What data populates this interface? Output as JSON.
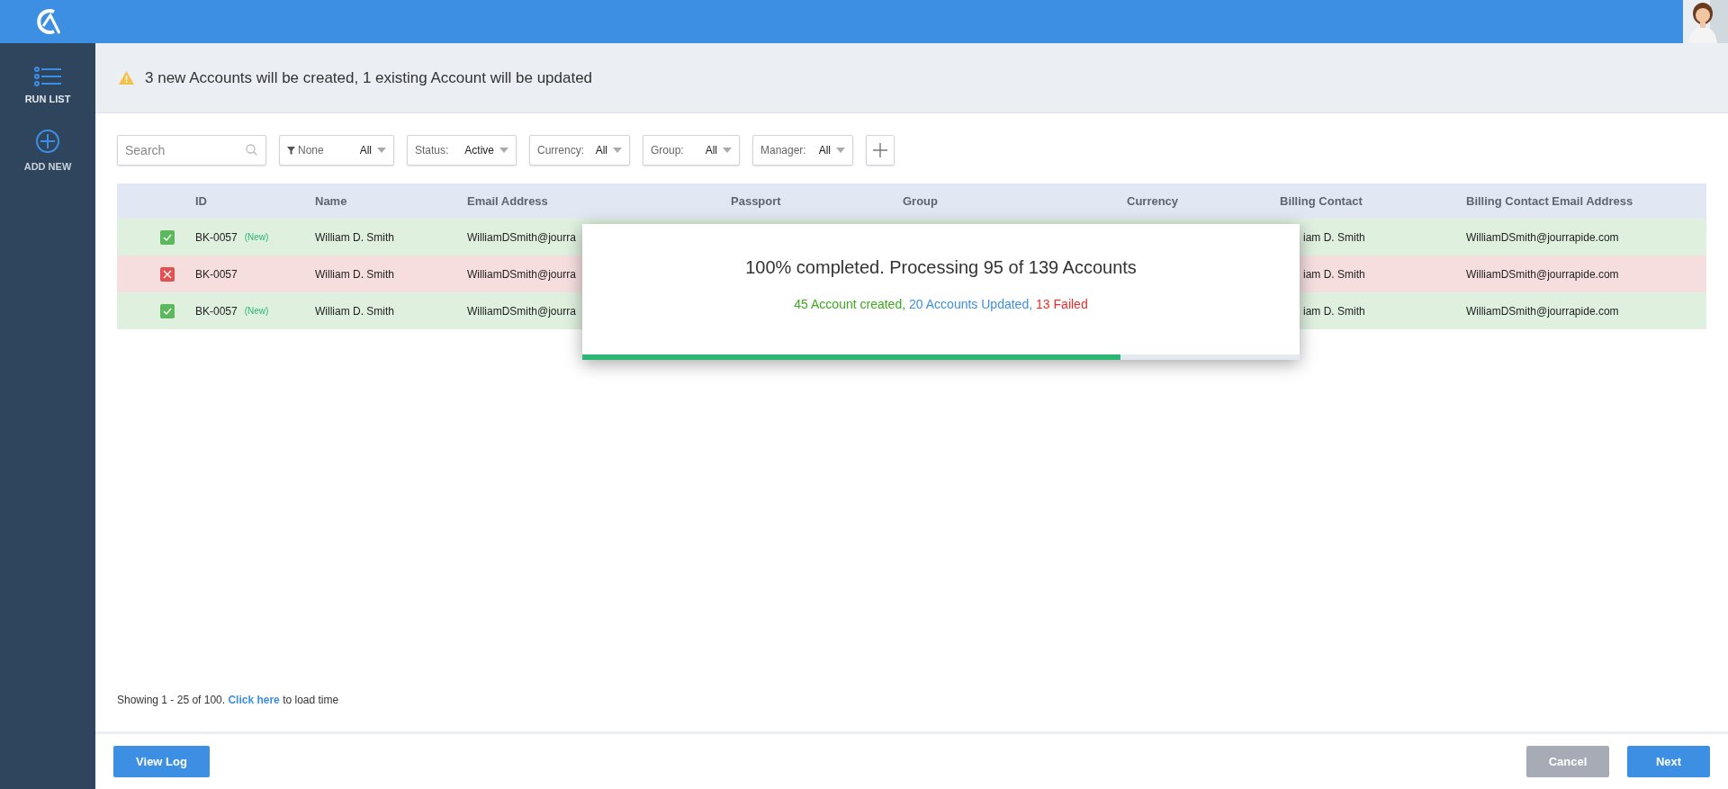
{
  "sidebar": {
    "items": [
      {
        "label": "RUN LIST",
        "kind": "list",
        "selected": true
      },
      {
        "label": "ADD NEW",
        "kind": "add",
        "selected": false
      }
    ]
  },
  "alert": {
    "text": "3 new Accounts will be created, 1 existing Account will be updated"
  },
  "filters": {
    "search": {
      "placeholder": "Search"
    },
    "dropdowns": [
      {
        "kind": "funnel",
        "label": "None",
        "value": "All"
      },
      {
        "kind": "plain",
        "label": "Status:",
        "value": "Active"
      },
      {
        "kind": "plain",
        "label": "Currency:",
        "value": "All"
      },
      {
        "kind": "plain",
        "label": "Group:",
        "value": "All"
      },
      {
        "kind": "plain",
        "label": "Manager:",
        "value": "All"
      }
    ]
  },
  "table": {
    "columns": [
      "ID",
      "Name",
      "Email Address",
      "Passport",
      "Group",
      "Currency",
      "Billing Contact",
      "Billing Contact Email Address"
    ],
    "rows": [
      {
        "failed": false,
        "id": "BK-0057",
        "badge": "(New)",
        "name": "William D. Smith",
        "email": "WilliamDSmith@jourra",
        "billing_contact": "iam D. Smith",
        "billing_email": "WilliamDSmith@jourrapide.com"
      },
      {
        "failed": true,
        "id": "BK-0057",
        "name": "William D. Smith",
        "email": "WilliamDSmith@jourra",
        "billing_contact": "iam D. Smith",
        "billing_email": "WilliamDSmith@jourrapide.com"
      },
      {
        "failed": false,
        "id": "BK-0057",
        "badge": "(New)",
        "name": "William D. Smith",
        "email": "WilliamDSmith@jourra",
        "billing_contact": "iam D. Smith",
        "billing_email": "WilliamDSmith@jourrapide.com"
      }
    ]
  },
  "progress_dialog": {
    "title": "100% completed. Processing 95 of 139 Accounts",
    "created": "45 Account created,",
    "updated": "20 Accounts Updated,",
    "failed": "13 Failed",
    "level": 0.75
  },
  "footer_note": {
    "before": "Showing 1 - 25 of 100.",
    "link": "Click here",
    "after": "to load time"
  },
  "buttons": [
    {
      "label": "View Log",
      "kind": "primary"
    },
    {
      "label": "Cancel",
      "kind": "secondary"
    },
    {
      "label": "Next",
      "kind": "primary"
    }
  ]
}
